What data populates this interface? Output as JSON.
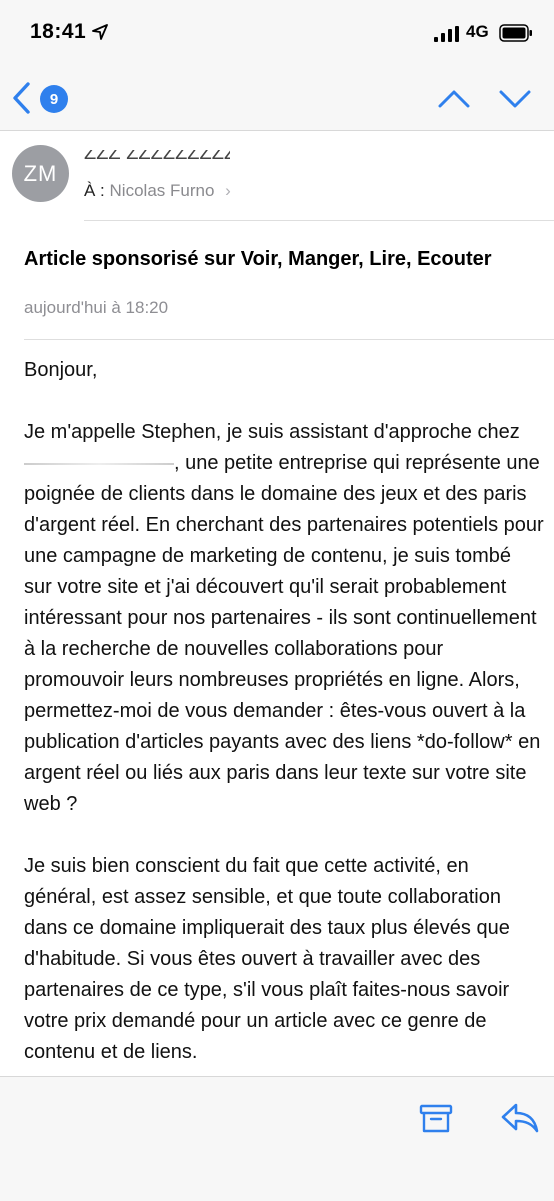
{
  "status_bar": {
    "time": "18:41",
    "network": "4G"
  },
  "nav": {
    "unread_count": "9"
  },
  "message": {
    "avatar_initials": "ZM",
    "sender_redacted": "ZZZ ZZZZZZZZZ",
    "to_label": "À :",
    "recipient": "Nicolas Furno",
    "subject": "Article sponsorisé sur Voir, Manger, Lire, Ecouter",
    "date": "aujourd'hui à 18:20",
    "greeting": "Bonjour,",
    "p1_start": "Je m'appelle Stephen, je suis assistant d'approche chez",
    "p1_rest": ", une petite entreprise qui représente une poignée de clients dans le domaine des jeux et des paris d'argent réel. En cherchant des partenaires potentiels pour une campagne de marketing de contenu, je suis tombé sur votre site et j'ai découvert qu'il serait probablement intéressant pour nos partenaires - ils sont continuellement à la recherche de nouvelles collaborations pour promouvoir leurs nombreuses propriétés en ligne. Alors, permettez-moi de vous demander : êtes-vous ouvert à la publication d'articles payants avec des liens *do-follow* en argent réel ou liés aux paris dans leur texte sur votre site web ?",
    "p2": "Je suis bien conscient du fait que cette activité, en général, est assez sensible, et que toute collaboration dans ce domaine impliquerait des taux plus élevés que d'habitude. Si vous êtes ouvert à travailler avec des partenaires de ce type, s'il vous plaît faites-nous savoir votre prix demandé pour un article avec ce genre de contenu et de liens."
  },
  "colors": {
    "accent": "#2f80ed",
    "avatar": "#9c9ea3"
  },
  "icons": {
    "back": "chevron-left-icon",
    "up": "chevron-up-icon",
    "down": "chevron-down-icon",
    "archive": "archive-icon",
    "reply": "reply-icon"
  }
}
